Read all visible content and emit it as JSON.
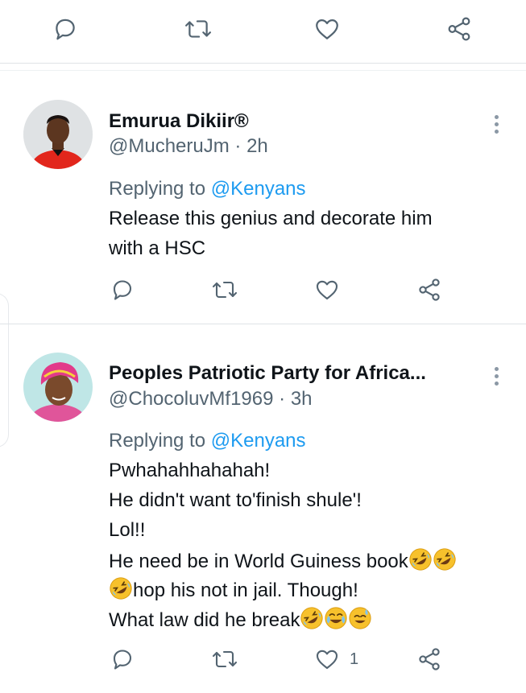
{
  "tweets": [
    {
      "name": "Emurua Dikiir®",
      "handle": "@MucheruJm",
      "separator": "·",
      "time": "2h",
      "replying_to_label": "Replying to",
      "replying_to_handle": "@Kenyans",
      "body_lines": [
        "Release this genius and decorate him",
        "with a HSC"
      ],
      "like_count": ""
    },
    {
      "name": "Peoples Patriotic Party for Africa...",
      "handle": "@ChocoluvMf1969",
      "separator": "·",
      "time": "3h",
      "replying_to_label": "Replying to",
      "replying_to_handle": "@Kenyans",
      "body_lines": [
        "Pwhahahhahahah!",
        "He didn't want to'finish shule'!",
        "Lol!!",
        "He need be in World Guiness book",
        "hop his not in jail. Though!",
        "What law did he break"
      ],
      "emojis": [
        "rolling-on-floor-laughing",
        "face-with-tears-of-joy",
        "grinning-face-with-sweat"
      ],
      "like_count": "1"
    }
  ],
  "icons": [
    "reply-icon",
    "retweet-icon",
    "like-icon",
    "share-icon",
    "more-icon"
  ],
  "colors": {
    "accent": "#1d9bf0",
    "secondary_text": "#536471",
    "emoji_yellow": "#f7c12c"
  }
}
